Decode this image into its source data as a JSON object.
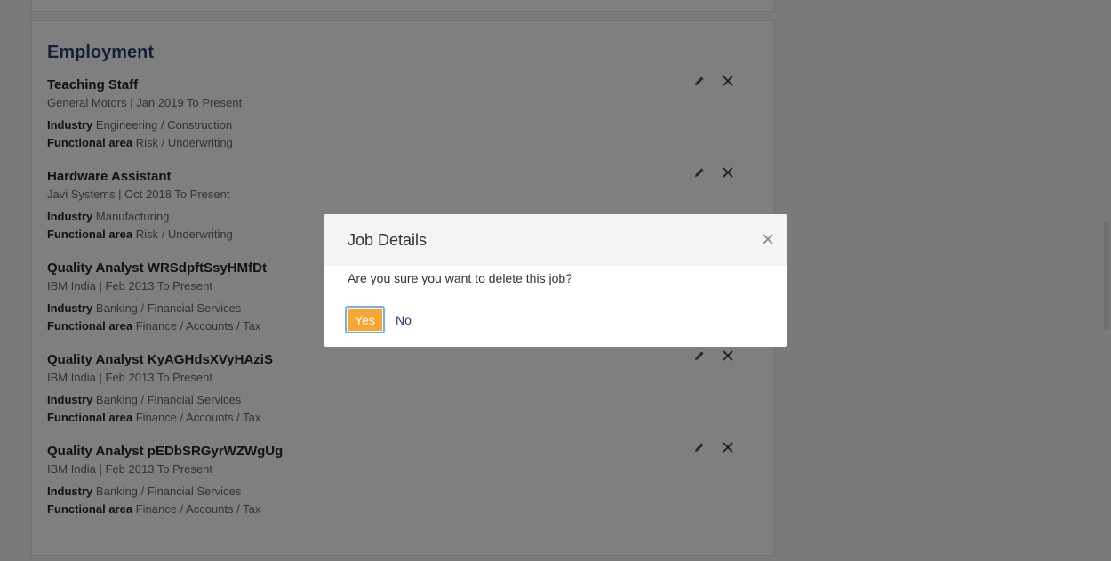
{
  "employment": {
    "section_title": "Employment",
    "industry_label": "Industry",
    "functional_area_label": "Functional area",
    "jobs": [
      {
        "title": "Teaching Staff",
        "meta": "General Motors | Jan 2019 To Present",
        "industry": "Engineering / Construction",
        "functional_area": "Risk / Underwriting"
      },
      {
        "title": "Hardware Assistant",
        "meta": "Javi Systems | Oct 2018 To Present",
        "industry": "Manufacturing",
        "functional_area": "Risk / Underwriting"
      },
      {
        "title": "Quality Analyst WRSdpftSsyHMfDt",
        "meta": "IBM India | Feb 2013 To Present",
        "industry": "Banking / Financial Services",
        "functional_area": "Finance / Accounts / Tax"
      },
      {
        "title": "Quality Analyst KyAGHdsXVyHAziS",
        "meta": "IBM India | Feb 2013 To Present",
        "industry": "Banking / Financial Services",
        "functional_area": "Finance / Accounts / Tax"
      },
      {
        "title": "Quality Analyst pEDbSRGyrWZWgUg",
        "meta": "IBM India | Feb 2013 To Present",
        "industry": "Banking / Financial Services",
        "functional_area": "Finance / Accounts / Tax"
      }
    ],
    "edit_icon": "pencil-icon",
    "delete_icon": "close-icon"
  },
  "modal": {
    "title": "Job Details",
    "message": "Are you sure you want to delete this job?",
    "yes_label": "Yes",
    "no_label": "No",
    "close_icon": "close-icon"
  },
  "colors": {
    "accent": "#f7a731",
    "heading": "#2b3e70",
    "focus_ring": "#79aee6"
  }
}
